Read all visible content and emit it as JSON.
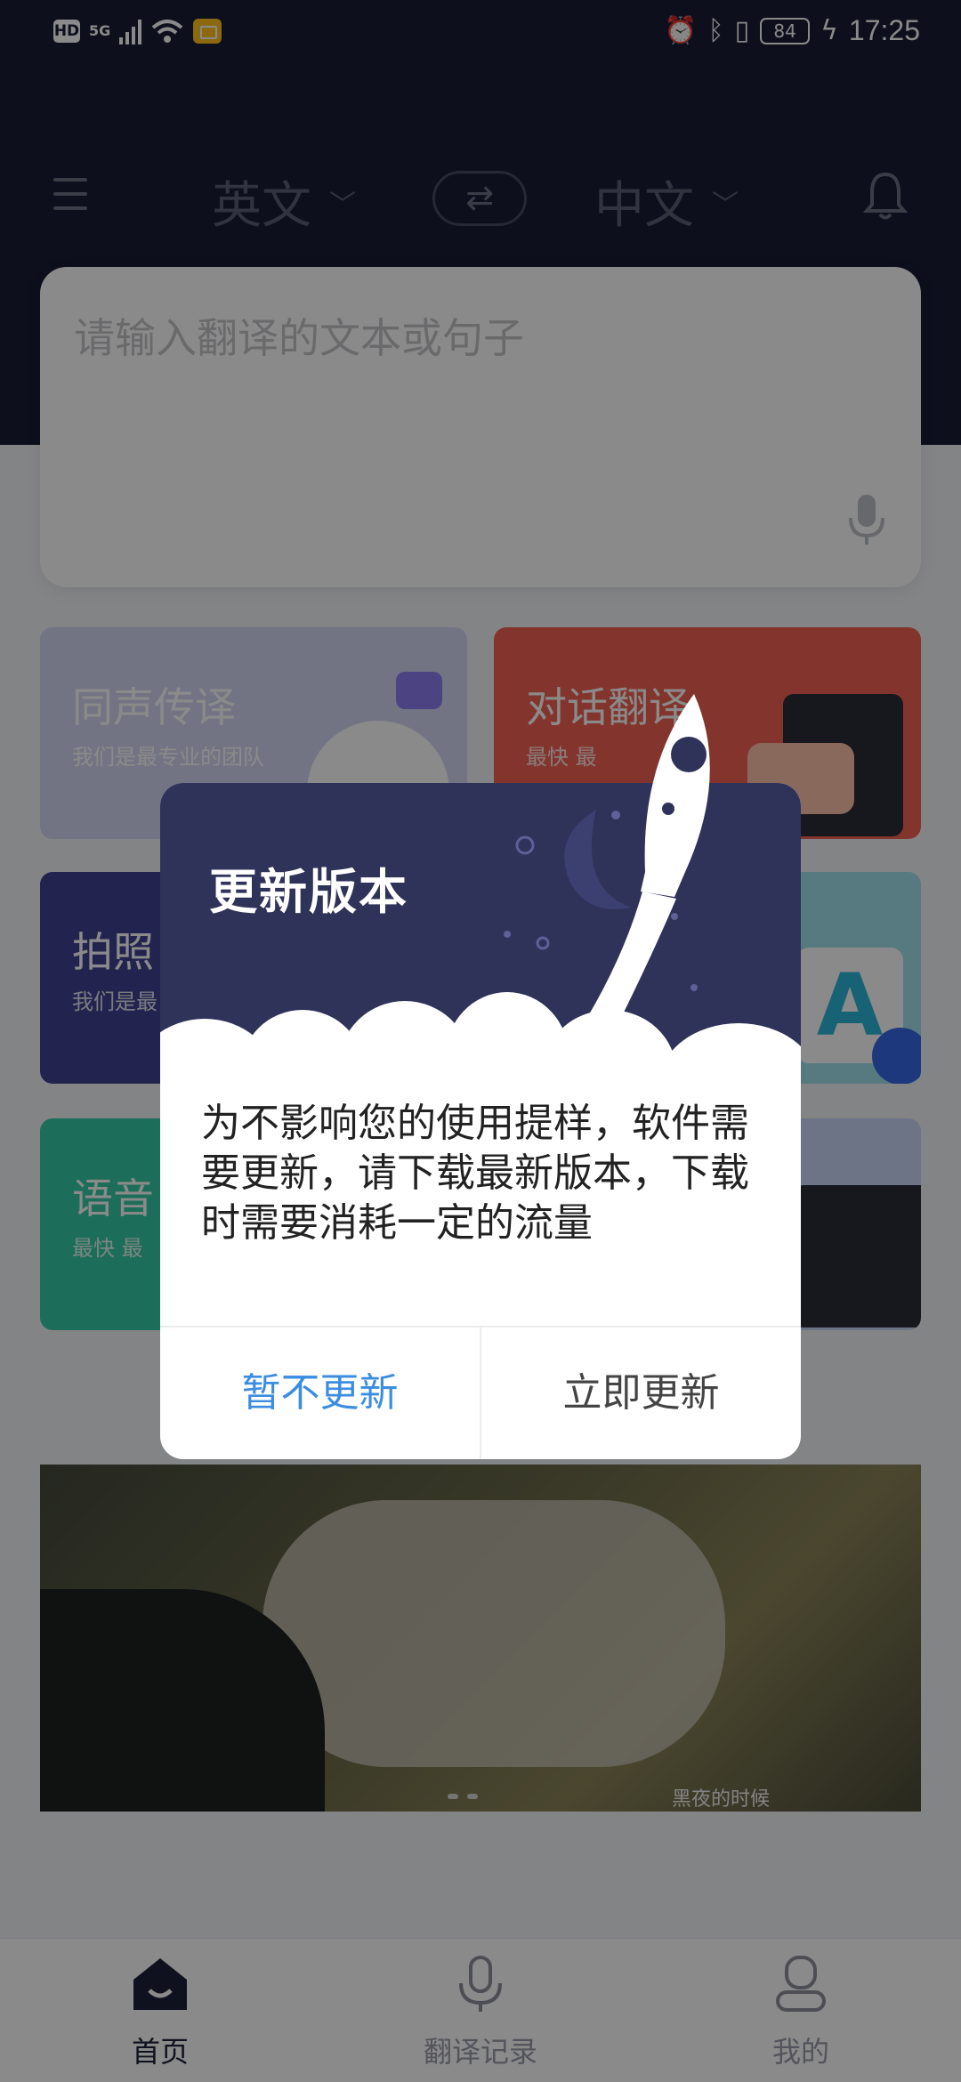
{
  "status_bar": {
    "hd": "HD",
    "network": "5G",
    "battery": "84",
    "time": "17:25"
  },
  "header": {
    "source_language": "英文",
    "target_language": "中文"
  },
  "input": {
    "placeholder": "请输入翻译的文本或句子"
  },
  "features": [
    {
      "title": "同声传译",
      "subtitle": "我们是最专业的团队"
    },
    {
      "title": "对话翻译",
      "subtitle": "最快 最"
    },
    {
      "title": "拍照",
      "subtitle": "我们是最"
    },
    {
      "title": "",
      "subtitle": ""
    },
    {
      "title": "语音",
      "subtitle": "最快 最"
    },
    {
      "title": "",
      "subtitle": ""
    }
  ],
  "banner": {
    "caption": "黑夜的时候"
  },
  "tabbar": {
    "items": [
      {
        "label": "首页",
        "icon": "home-icon",
        "active": true
      },
      {
        "label": "翻译记录",
        "icon": "microphone-icon",
        "active": false
      },
      {
        "label": "我的",
        "icon": "user-icon",
        "active": false
      }
    ]
  },
  "dialog": {
    "title": "更新版本",
    "message": "为不影响您的使用提样，软件需要更新，请下载最新版本，下载时需要消耗一定的流量",
    "cancel_label": "暂不更新",
    "confirm_label": "立即更新"
  },
  "colors": {
    "header_bg": "#181c36",
    "dialog_head": "#2f3259",
    "link_blue": "#3a8de0",
    "card_simultaneous": "#d3d7f4",
    "card_dialogue": "#f26152",
    "card_photo": "#3f4492",
    "card_text": "#9fe2ea",
    "card_voice": "#35c9a4",
    "card_audio": "#c8d6f6"
  }
}
